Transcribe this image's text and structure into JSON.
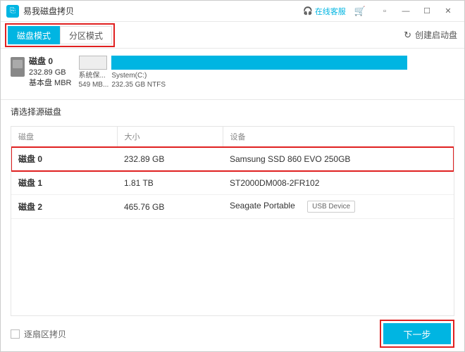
{
  "titlebar": {
    "title": "易我磁盘拷贝",
    "online_support": "在线客服"
  },
  "toolbar": {
    "disk_mode": "磁盘模式",
    "partition_mode": "分区模式",
    "create_boot_disk": "创建启动盘"
  },
  "disk_summary": {
    "name": "磁盘 0",
    "size": "232.89 GB",
    "type": "基本盘 MBR",
    "partitions": [
      {
        "label": "系统保...",
        "sub": "549 MB..."
      },
      {
        "label": "System(C:)",
        "sub": "232.35 GB NTFS"
      }
    ]
  },
  "prompt": "请选择源磁盘",
  "table": {
    "headers": {
      "disk": "磁盘",
      "size": "大小",
      "device": "设备"
    },
    "rows": [
      {
        "name": "磁盘 0",
        "size": "232.89 GB",
        "device": "Samsung SSD 860 EVO 250GB",
        "badge": ""
      },
      {
        "name": "磁盘 1",
        "size": "1.81 TB",
        "device": "ST2000DM008-2FR102",
        "badge": ""
      },
      {
        "name": "磁盘 2",
        "size": "465.76 GB",
        "device": "Seagate  Portable",
        "badge": "USB Device"
      }
    ]
  },
  "footer": {
    "sector_copy": "逐扇区拷贝",
    "next": "下一步"
  }
}
